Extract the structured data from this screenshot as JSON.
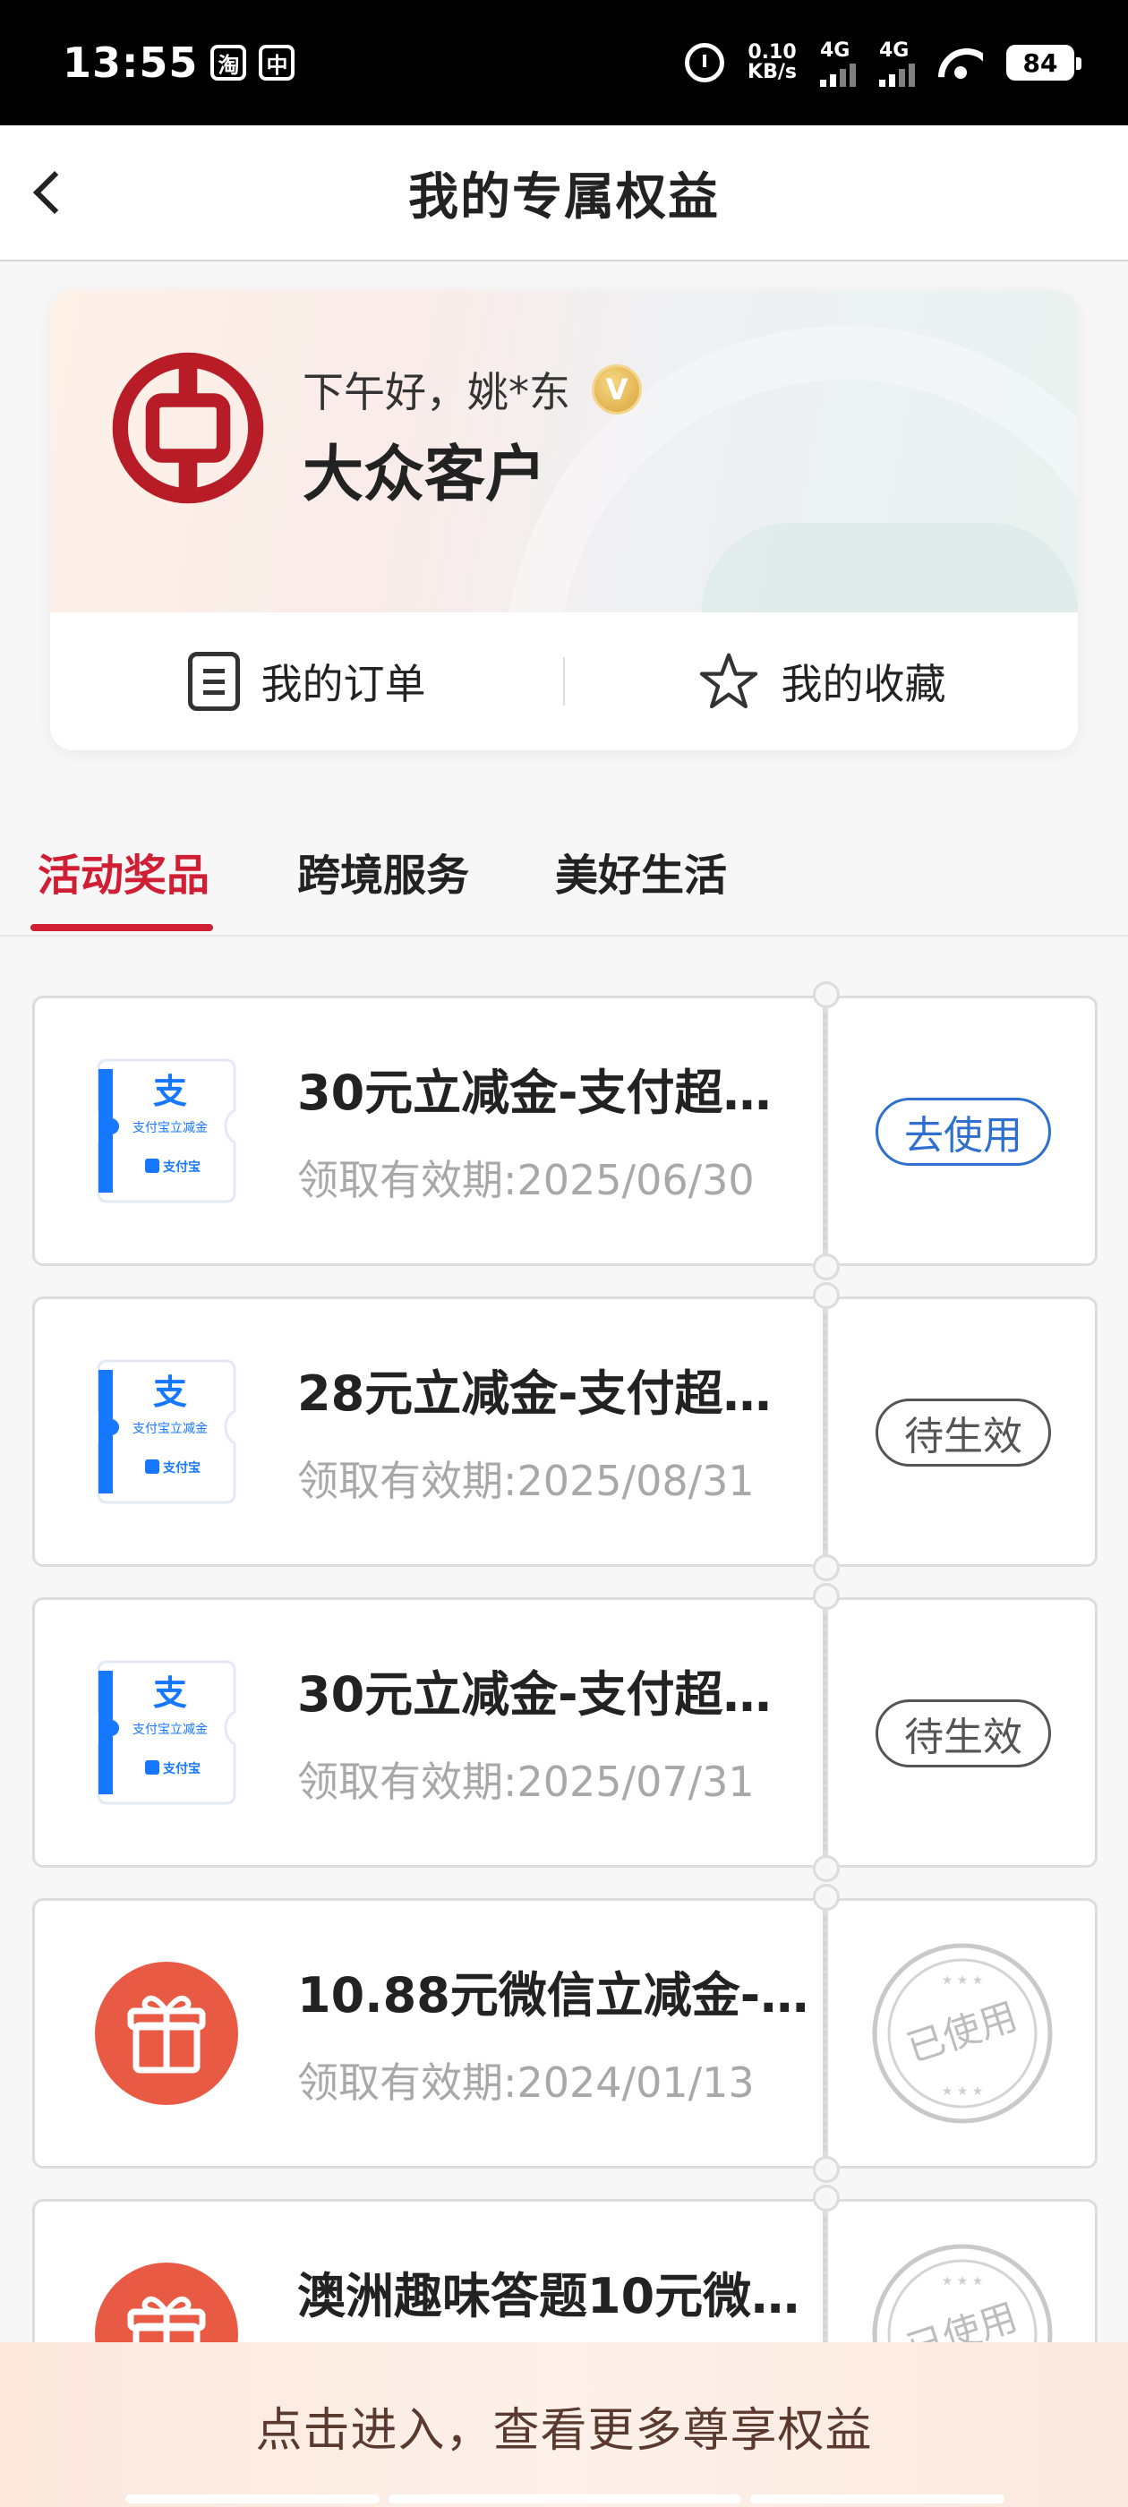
{
  "status_bar": {
    "time": "13:55",
    "app_icons": [
      "淘",
      "中"
    ],
    "speed_value": "0.10",
    "speed_unit": "KB/s",
    "sim1": "4G",
    "sim2": "4G",
    "battery": "84"
  },
  "header": {
    "title": "我的专属权益"
  },
  "profile": {
    "greeting": "下午好，姚*东",
    "badge": "V",
    "level": "大众客户",
    "actions": {
      "orders": "我的订单",
      "favorites": "我的收藏"
    }
  },
  "tabs": [
    {
      "label": "活动奖品",
      "active": true
    },
    {
      "label": "跨境服务",
      "active": false
    },
    {
      "label": "美好生活",
      "active": false
    }
  ],
  "coupons": [
    {
      "title": "30元立减金-支付超…",
      "expiry": "领取有效期:2025/06/30",
      "status": "去使用",
      "icon": "alipay-coupon-icon",
      "icon_text": "支付宝立减金",
      "icon_logo": "支付宝"
    },
    {
      "title": "28元立减金-支付超…",
      "expiry": "领取有效期:2025/08/31",
      "status": "待生效",
      "icon": "alipay-coupon-icon",
      "icon_text": "支付宝立减金",
      "icon_logo": "支付宝"
    },
    {
      "title": "30元立减金-支付超…",
      "expiry": "领取有效期:2025/07/31",
      "status": "待生效",
      "icon": "alipay-coupon-icon",
      "icon_text": "支付宝立减金",
      "icon_logo": "支付宝"
    },
    {
      "title": "10.88元微信立减金-…",
      "expiry": "领取有效期:2024/01/13",
      "status": "已使用",
      "icon": "gift-icon"
    },
    {
      "title": "澳洲趣味答题10元微…",
      "expiry": "",
      "status": "已使用",
      "icon": "gift-icon"
    }
  ],
  "bottom_banner": {
    "text": "点击进入，查看更多尊享权益"
  },
  "colors": {
    "accent_red": "#d01f35",
    "use_blue": "#2f6fd0",
    "gift_orange": "#e85a44",
    "alipay_blue": "#1677ff"
  }
}
